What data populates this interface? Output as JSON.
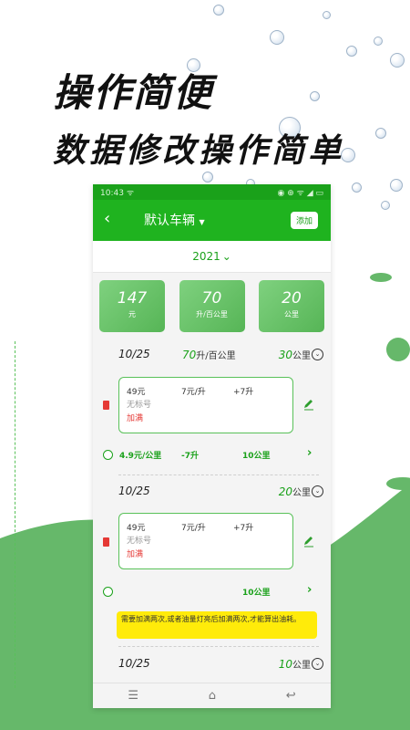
{
  "hero": {
    "title": "操作简便",
    "subtitle": "数据修改操作简单"
  },
  "status": {
    "time": "10:43",
    "indicator": "ᯤ",
    "right": "◉ ⊕ ᯤ ◢ ▭"
  },
  "appbar": {
    "back_icon": "arrow-left-icon",
    "title": "默认车辆",
    "title_caret": "▼",
    "add_label": "添加"
  },
  "year": {
    "label": "2021",
    "caret": "⌄"
  },
  "stats": [
    {
      "value": "147",
      "unit": "元"
    },
    {
      "value": "70",
      "unit": "升/百公里"
    },
    {
      "value": "20",
      "unit": "公里"
    }
  ],
  "records": [
    {
      "date": "10/25",
      "consumption": "70",
      "consumption_unit": "升/百公里",
      "distance": "30",
      "distance_unit": "公里",
      "expand_icon": "⌄",
      "card": {
        "amount": "49元",
        "price": "7元/升",
        "liters": "+7升",
        "tag": "无标号",
        "status": "加满"
      },
      "summary": {
        "cost_per_km": "4.9元/公里",
        "liter_change": "-7升",
        "km": "10公里",
        "arrow": "›"
      }
    },
    {
      "date": "10/25",
      "distance": "20",
      "distance_unit": "公里",
      "expand_icon": "⌄",
      "card": {
        "amount": "49元",
        "price": "7元/升",
        "liters": "+7升",
        "tag": "无标号",
        "status": "加满"
      },
      "summary": {
        "km": "10公里",
        "arrow": "›"
      }
    },
    {
      "date": "10/25",
      "distance": "10",
      "distance_unit": "公里",
      "expand_icon": "⌄"
    }
  ],
  "tip": "需要加满两次,或者油量灯亮后加满两次,才能算出油耗。",
  "nav": {
    "menu": "☰",
    "home": "⌂",
    "back": "↩"
  },
  "colors": {
    "primary": "#1fb31f",
    "card_border": "#59c159",
    "warning": "#e53935",
    "tip_bg": "#ffeb0a"
  }
}
